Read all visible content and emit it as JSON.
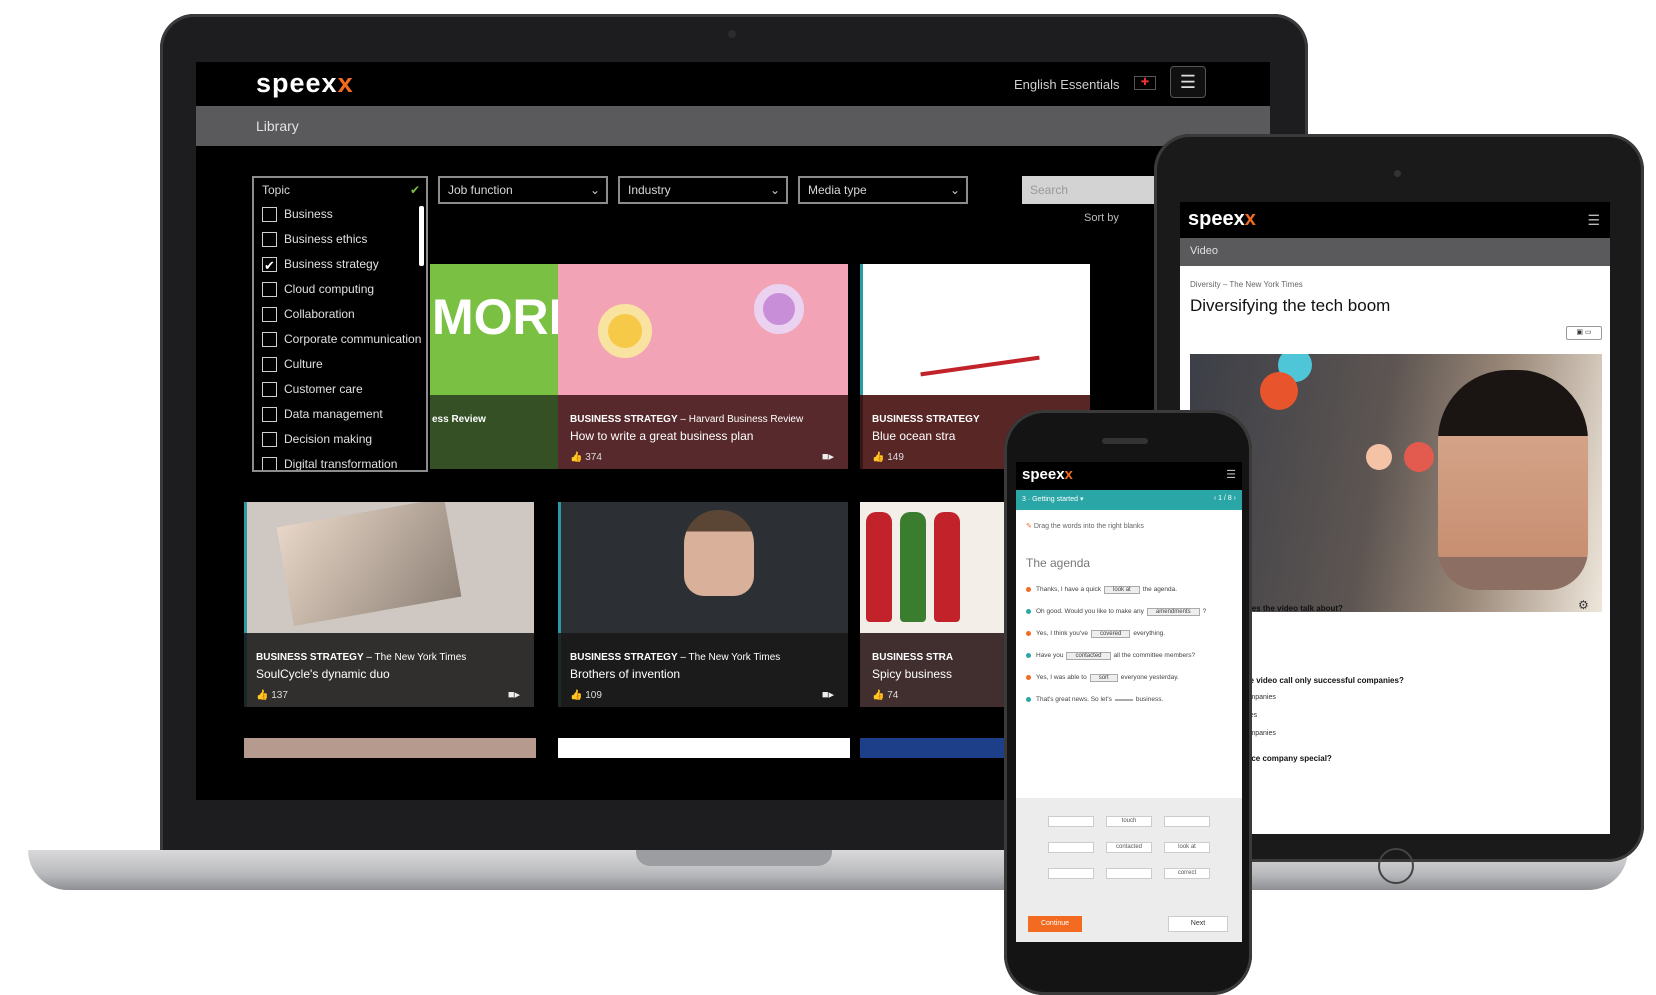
{
  "laptop": {
    "logo_main": "speex",
    "logo_accent": "x",
    "course": "English Essentials",
    "flag": "✚",
    "breadcrumb": "Library",
    "filters": {
      "topic": "Topic",
      "job_function": "Job function",
      "industry": "Industry",
      "media_type": "Media type",
      "search_placeholder": "Search"
    },
    "sort_label": "Sort by",
    "topics": [
      {
        "label": "Business",
        "checked": false
      },
      {
        "label": "Business ethics",
        "checked": false
      },
      {
        "label": "Business strategy",
        "checked": true
      },
      {
        "label": "Cloud computing",
        "checked": false
      },
      {
        "label": "Collaboration",
        "checked": false
      },
      {
        "label": "Corporate communication",
        "checked": false
      },
      {
        "label": "Culture",
        "checked": false
      },
      {
        "label": "Customer care",
        "checked": false
      },
      {
        "label": "Data management",
        "checked": false
      },
      {
        "label": "Decision making",
        "checked": false
      },
      {
        "label": "Digital transformation",
        "checked": false
      }
    ],
    "cards": [
      {
        "tag": "",
        "source": "ess Review",
        "title": "",
        "likes": "",
        "accent": "#7ac143"
      },
      {
        "tag": "BUSINESS STRATEGY",
        "source": " – Harvard Business Review",
        "title": "How to write a great business plan",
        "likes": "374",
        "accent": "#f4a7b9"
      },
      {
        "tag": "BUSINESS STRATEGY",
        "source": "",
        "title": "Blue ocean stra",
        "likes": "149",
        "accent": "#ffffff"
      },
      {
        "tag": "BUSINESS STRATEGY",
        "source": " – The New York Times",
        "title": "SoulCycle's dynamic duo",
        "likes": "137",
        "accent": "#cfc8c2"
      },
      {
        "tag": "BUSINESS STRATEGY",
        "source": " – The New York Times",
        "title": "Brothers of invention",
        "likes": "109",
        "accent": "#2c2f33"
      },
      {
        "tag": "BUSINESS STRA",
        "source": "",
        "title": "Spicy business",
        "likes": "74",
        "accent": "#c2232b"
      }
    ]
  },
  "tablet": {
    "logo_main": "speex",
    "logo_accent": "x",
    "breadcrumb": "Video",
    "subtitle": "Diversity – The New York Times",
    "title": "Diversifying the tech boom",
    "q1": "does the video talk about?",
    "q2": "the video call only successful companies?",
    "a1": "companies",
    "a2": "ones",
    "a3": "companies",
    "q3": "ence company special?"
  },
  "phone": {
    "logo_main": "speex",
    "logo_accent": "x",
    "section": "3 · Getting started ▾",
    "pager": "‹ 1 / 8 ›",
    "instruction": "Drag the words into the right blanks",
    "heading": "The agenda",
    "lines": [
      {
        "pre": "Thanks, I have a quick",
        "gap": "look at",
        "post": "the agenda.",
        "color": "#f26b21"
      },
      {
        "pre": "Oh good. Would you like to make any",
        "gap": "amendments",
        "post": "?",
        "color": "#2ba6a6"
      },
      {
        "pre": "Yes, I think you've",
        "gap": "covered",
        "post": "everything.",
        "color": "#f26b21"
      },
      {
        "pre": "Have you",
        "gap": "contacted",
        "post": "all the committee members?",
        "color": "#2ba6a6"
      },
      {
        "pre": "Yes, I was able to",
        "gap": "sort",
        "post": "everyone yesterday.",
        "color": "#f26b21"
      },
      {
        "pre": "That's great news. So let's",
        "gap": "",
        "post": "business.",
        "color": "#2ba6a6"
      }
    ],
    "chips": [
      "",
      "touch",
      "",
      "",
      "contacted",
      "look at",
      "",
      "",
      "correct"
    ],
    "continue": "Continue",
    "next": "Next"
  }
}
